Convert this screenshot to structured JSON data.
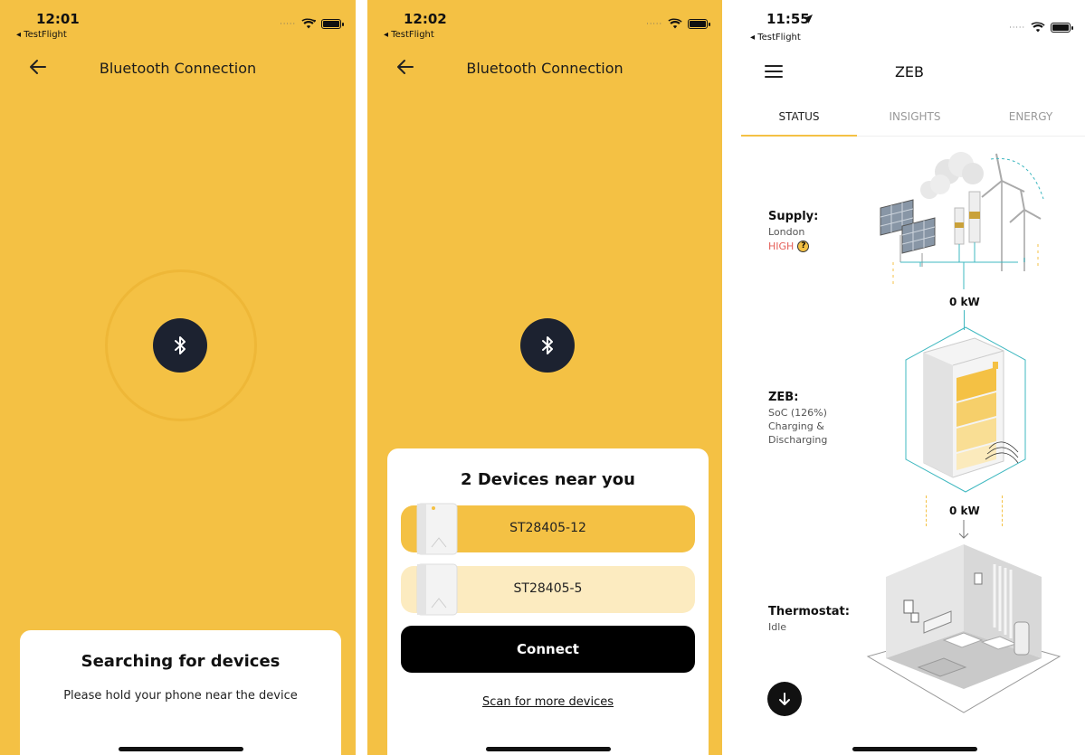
{
  "screen1": {
    "time": "12:01",
    "testflight": "◂ TestFlight",
    "title": "Bluetooth Connection",
    "sheet_title": "Searching for devices",
    "sheet_text": "Please hold your phone near the device"
  },
  "screen2": {
    "time": "12:02",
    "testflight": "◂ TestFlight",
    "title": "Bluetooth Connection",
    "sheet_title": "2 Devices near you",
    "devices": [
      {
        "label": "ST28405-12",
        "selected": true
      },
      {
        "label": "ST28405-5",
        "selected": false
      }
    ],
    "connect_label": "Connect",
    "scan_label": "Scan for more devices"
  },
  "screen3": {
    "time": "11:55",
    "testflight": "◂ TestFlight",
    "title": "ZEB",
    "tabs": [
      "STATUS",
      "INSIGHTS",
      "ENERGY"
    ],
    "active_tab": "STATUS",
    "supply": {
      "title": "Supply:",
      "location": "London",
      "level": "HIGH",
      "help": "?"
    },
    "supply_kw": "0 kW",
    "zeb": {
      "title": "ZEB:",
      "lines": [
        "SoC (126%)",
        "Charging &",
        "Discharging"
      ]
    },
    "home_kw": "0 kW",
    "thermostat": {
      "title": "Thermostat:",
      "status": "Idle"
    }
  },
  "colors": {
    "accent": "#F4C144",
    "dark": "#1C2230",
    "high": "#E5605A",
    "teal": "#3FB8C0"
  }
}
